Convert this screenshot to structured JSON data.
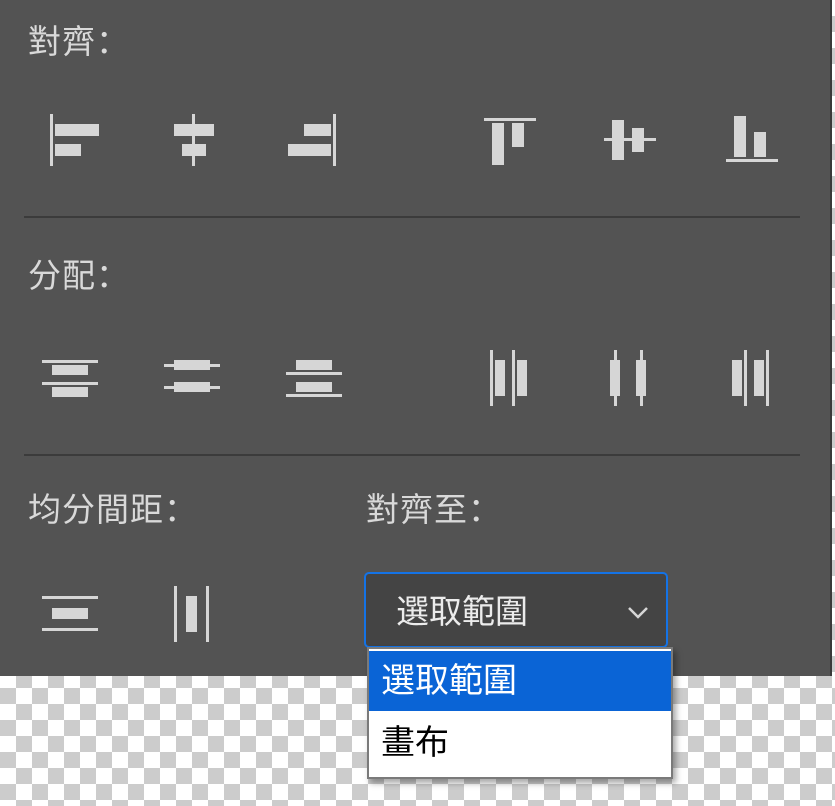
{
  "panel": {
    "align_label": "對齊：",
    "distribute_label": "分配：",
    "spacing_label": "均分間距：",
    "align_to_label": "對齊至：",
    "align_icons": [
      "align-left-edges-icon",
      "align-horizontal-centers-icon",
      "align-right-edges-icon",
      "align-top-edges-icon",
      "align-vertical-centers-icon",
      "align-bottom-edges-icon"
    ],
    "distribute_icons": [
      "distribute-top-edges-icon",
      "distribute-vertical-centers-icon",
      "distribute-bottom-edges-icon",
      "distribute-left-edges-icon",
      "distribute-horizontal-centers-icon",
      "distribute-right-edges-icon"
    ],
    "spacing_icons": [
      "distribute-vertical-spacing-icon",
      "distribute-horizontal-spacing-icon"
    ]
  },
  "align_to": {
    "selected": "選取範圍",
    "options": [
      "選取範圍",
      "畫布"
    ]
  },
  "colors": {
    "panel_bg": "#535353",
    "accent": "#1473e6",
    "selected_option_bg": "#0a64d6"
  }
}
